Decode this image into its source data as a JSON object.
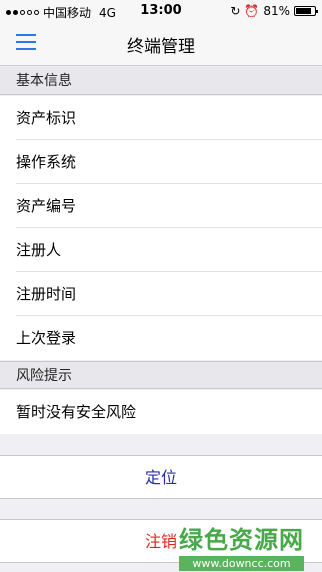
{
  "status_bar": {
    "carrier": "中国移动",
    "network": "4G",
    "time": "13:00",
    "battery": "81%",
    "battery_level": 0.81
  },
  "nav": {
    "title": "终端管理"
  },
  "basic_info": {
    "header": "基本信息",
    "rows": [
      "资产标识",
      "操作系统",
      "资产编号",
      "注册人",
      "注册时间",
      "上次登录"
    ]
  },
  "risk": {
    "header": "风险提示",
    "message": "暂时没有安全风险"
  },
  "actions": {
    "locate": "定位",
    "logout": "注销"
  },
  "watermark": {
    "title": "绿色资源网",
    "url": "www.downcc.com"
  },
  "colors": {
    "accent": "#2a7ae2",
    "locate": "#2a2aa8",
    "logout": "#e0281f"
  }
}
